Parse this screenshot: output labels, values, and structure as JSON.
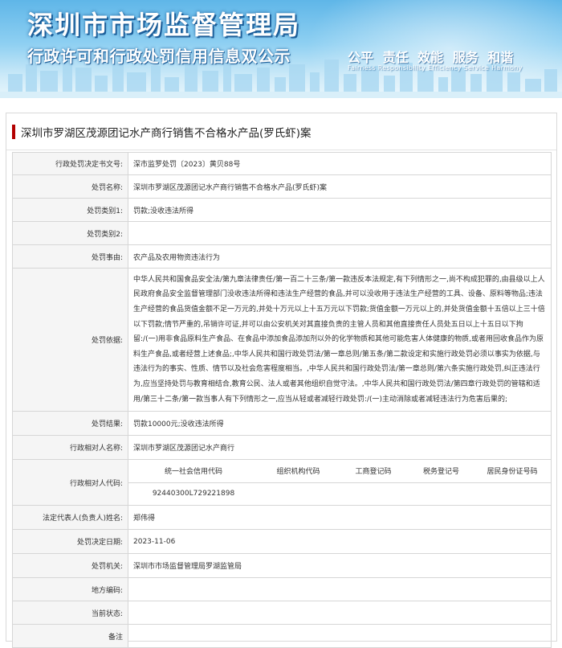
{
  "banner": {
    "title": "深圳市市场监督管理局",
    "subtitle": "行政许可和行政处罚信用信息双公示",
    "motto": "公平  责任  效能  服务  和谐",
    "motto_en": "Fairness  Responsibility  Efficiency  Service  Harmony"
  },
  "case": {
    "title": "深圳市罗湖区茂源团记水产商行销售不合格水产品(罗氏虾)案",
    "rows": [
      {
        "label": "行政处罚决定书文号:",
        "value": "深市监罗处罚〔2023〕黄贝88号"
      },
      {
        "label": "处罚名称:",
        "value": "深圳市罗湖区茂源团记水产商行销售不合格水产品(罗氏虾)案"
      },
      {
        "label": "处罚类别1:",
        "value": "罚款;没收违法所得"
      },
      {
        "label": "处罚类别2:",
        "value": ""
      },
      {
        "label": "处罚事由:",
        "value": "农产品及农用物资违法行为"
      },
      {
        "label": "处罚依据:",
        "value": "中华人民共和国食品安全法/第九章法律责任/第一百二十三条/第一款违反本法规定,有下列情形之一,尚不构成犯罪的,由县级以上人民政府食品安全监督管理部门没收违法所得和违法生产经营的食品,并可以没收用于违法生产经营的工具、设备、原料等物品;违法生产经营的食品货值金额不足一万元的,并处十万元以上十五万元以下罚款;货值金额一万元以上的,并处货值金额十五倍以上三十倍以下罚款;情节严重的,吊销许可证,并可以由公安机关对其直接负责的主管人员和其他直接责任人员处五日以上十五日以下拘留:/(一)用非食品原料生产食品、在食品中添加食品添加剂以外的化学物质和其他可能危害人体健康的物质,或者用回收食品作为原料生产食品,或者经营上述食品;,中华人民共和国行政处罚法/第一章总则/第五条/第二款设定和实施行政处罚必须以事实为依据,与违法行为的事实、性质、情节以及社会危害程度相当。,中华人民共和国行政处罚法/第一章总则/第六条实施行政处罚,纠正违法行为,应当坚持处罚与教育相结合,教育公民、法人或者其他组织自觉守法。,中华人民共和国行政处罚法/第四章行政处罚的管辖和适用/第三十二条/第一款当事人有下列情形之一,应当从轻或者减轻行政处罚:/(一)主动消除或者减轻违法行为危害后果的;"
      },
      {
        "label": "处罚结果:",
        "value": "罚款10000元;没收违法所得"
      },
      {
        "label": "行政相对人名称:",
        "value": "深圳市罗湖区茂源团记水产商行"
      }
    ],
    "code_label": "行政相对人代码:",
    "code_headers": [
      "统一社会信用代码",
      "组织机构代码",
      "工商登记码",
      "税务登记号",
      "居民身份证号码"
    ],
    "code_values": [
      "92440300L729221898",
      "",
      "",
      "",
      ""
    ],
    "rows2": [
      {
        "label": "法定代表人(负责人)姓名:",
        "value": "郑伟得"
      },
      {
        "label": "处罚决定日期:",
        "value": "2023-11-06"
      },
      {
        "label": "处罚机关:",
        "value": "深圳市市场监督管理局罗湖监管局"
      },
      {
        "label": "地方编码:",
        "value": ""
      },
      {
        "label": "当前状态:",
        "value": ""
      },
      {
        "label": "备注",
        "value": ""
      }
    ]
  },
  "colors": {
    "accent_bar": "#b30000",
    "label_bg": "#f5f5f5",
    "border": "#d6d6d6"
  }
}
